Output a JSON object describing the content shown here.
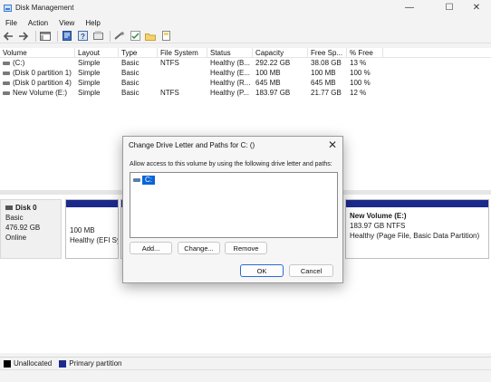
{
  "window": {
    "title": "Disk Management"
  },
  "menu": [
    "File",
    "Action",
    "View",
    "Help"
  ],
  "volume_table": {
    "columns": [
      "Volume",
      "Layout",
      "Type",
      "File System",
      "Status",
      "Capacity",
      "Free Sp...",
      "% Free"
    ],
    "rows": [
      [
        "(C:)",
        "Simple",
        "Basic",
        "NTFS",
        "Healthy (B...",
        "292.22 GB",
        "38.08 GB",
        "13 %"
      ],
      [
        "(Disk 0 partition 1)",
        "Simple",
        "Basic",
        "",
        "Healthy (E...",
        "100 MB",
        "100 MB",
        "100 %"
      ],
      [
        "(Disk 0 partition 4)",
        "Simple",
        "Basic",
        "",
        "Healthy (R...",
        "645 MB",
        "645 MB",
        "100 %"
      ],
      [
        "New Volume (E:)",
        "Simple",
        "Basic",
        "NTFS",
        "Healthy (P...",
        "183.97 GB",
        "21.77 GB",
        "12 %"
      ]
    ]
  },
  "disk": {
    "name": "Disk 0",
    "type": "Basic",
    "size": "476.92 GB",
    "status": "Online",
    "partitions": [
      {
        "size": "100 MB",
        "status": "Healthy (EFI Sy"
      },
      {
        "title": "New Volume  (E:)",
        "size": "183.97 GB NTFS",
        "status": "Healthy (Page File, Basic Data Partition)"
      }
    ]
  },
  "legend": [
    {
      "label": "Unallocated",
      "color": "#000000"
    },
    {
      "label": "Primary partition",
      "color": "#1c2a8c"
    }
  ],
  "dialog": {
    "title": "Change Drive Letter and Paths for C: ()",
    "description": "Allow access to this volume by using the following drive letter and paths:",
    "list_items": [
      "C:"
    ],
    "buttons": {
      "add": "Add...",
      "change": "Change...",
      "remove": "Remove",
      "ok": "OK",
      "cancel": "Cancel"
    }
  }
}
